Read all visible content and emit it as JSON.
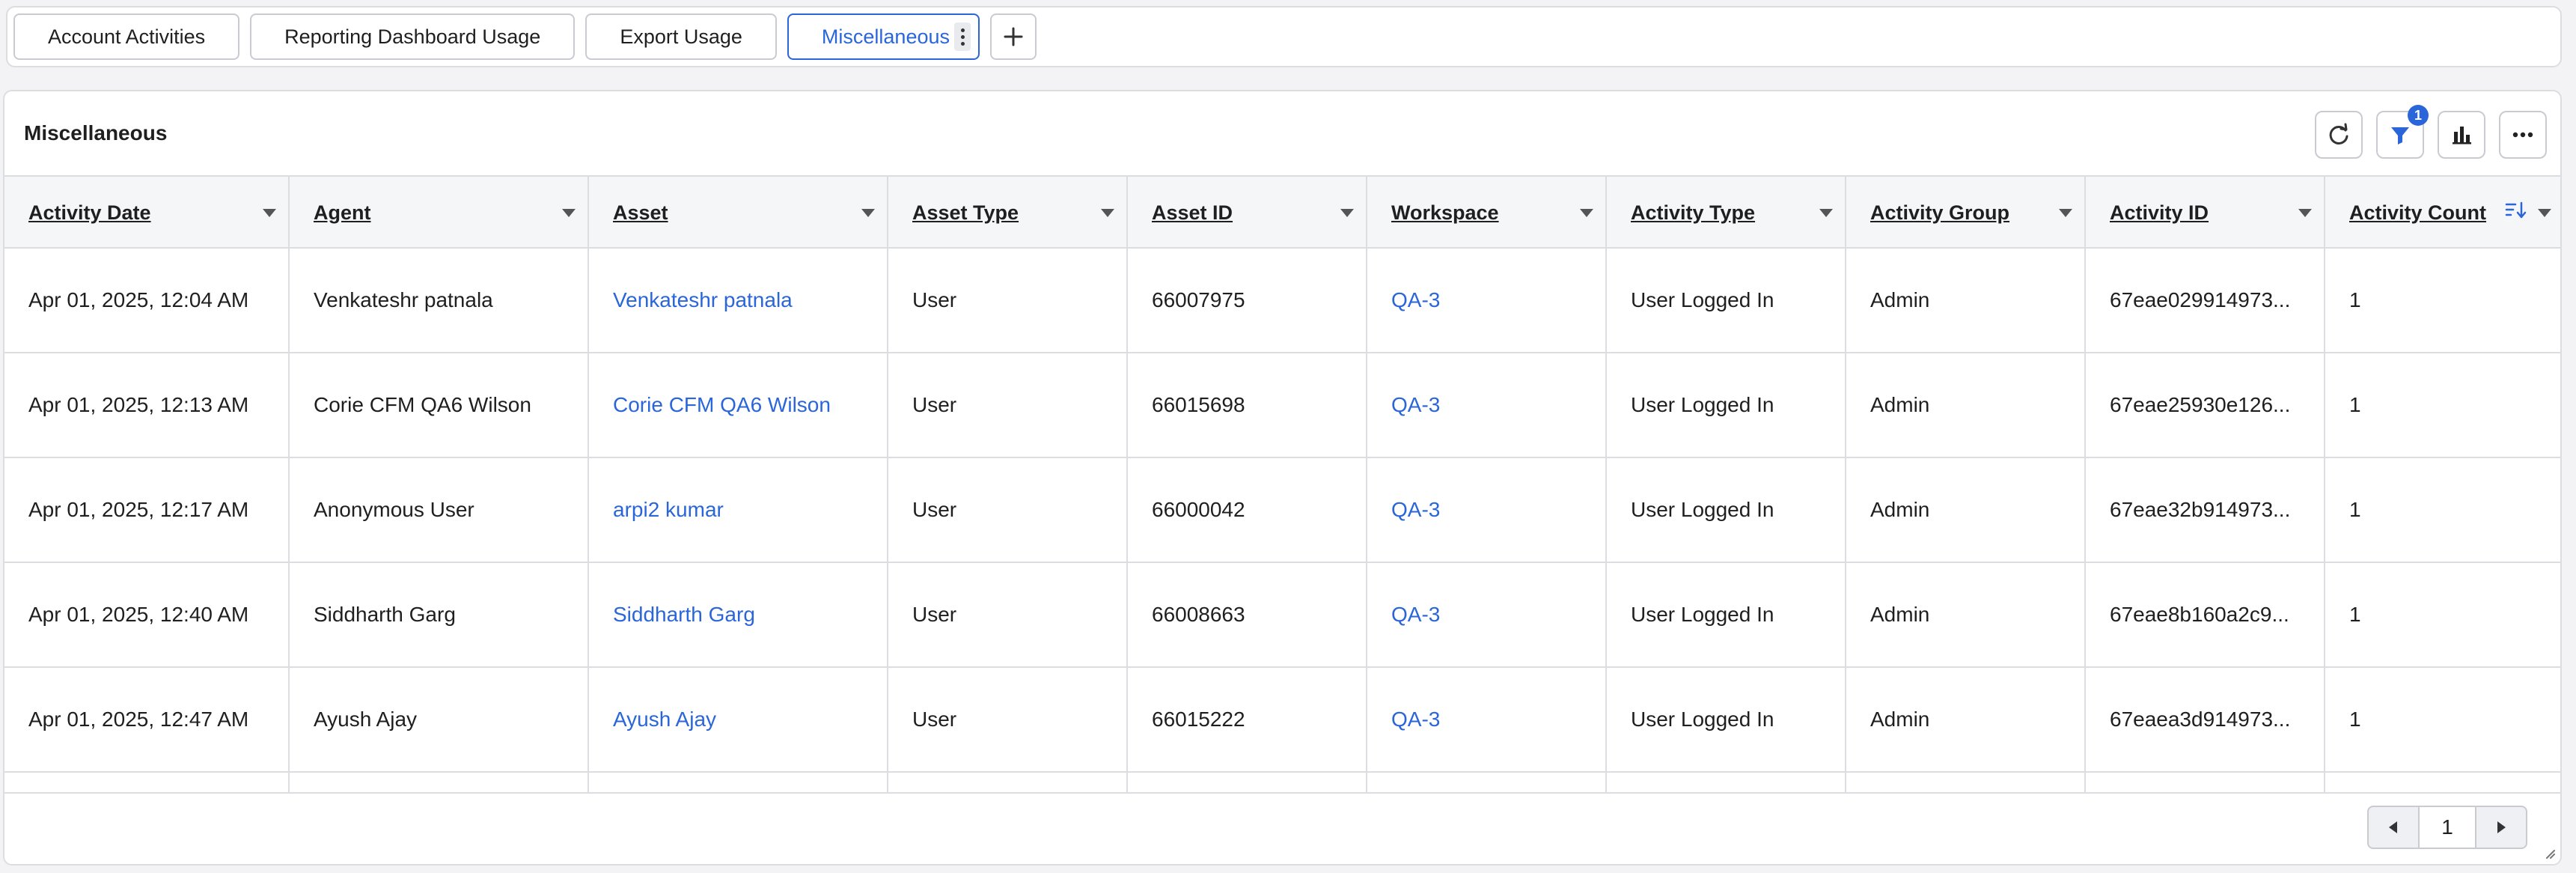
{
  "tabs": [
    {
      "label": "Account Activities",
      "active": false
    },
    {
      "label": "Reporting Dashboard Usage",
      "active": false
    },
    {
      "label": "Export Usage",
      "active": false
    },
    {
      "label": "Miscellaneous",
      "active": true
    }
  ],
  "widget": {
    "title": "Miscellaneous",
    "filter_badge": "1",
    "icons": [
      "refresh-icon",
      "filter-icon",
      "bar-chart-icon",
      "more-icon"
    ]
  },
  "table": {
    "columns": [
      "Activity Date",
      "Agent",
      "Asset",
      "Asset Type",
      "Asset ID",
      "Workspace",
      "Activity Type",
      "Activity Group",
      "Activity ID",
      "Activity Count"
    ],
    "rows": [
      [
        "Apr 01, 2025, 12:04 AM",
        "Venkateshr patnala",
        "Venkateshr patnala",
        "User",
        "66007975",
        "QA-3",
        "User Logged In",
        "Admin",
        "67eae029914973...",
        "1"
      ],
      [
        "Apr 01, 2025, 12:13 AM",
        "Corie CFM QA6 Wilson",
        "Corie CFM QA6 Wilson",
        "User",
        "66015698",
        "QA-3",
        "User Logged In",
        "Admin",
        "67eae25930e126...",
        "1"
      ],
      [
        "Apr 01, 2025, 12:17 AM",
        "Anonymous User",
        "arpi2 kumar",
        "User",
        "66000042",
        "QA-3",
        "User Logged In",
        "Admin",
        "67eae32b914973...",
        "1"
      ],
      [
        "Apr 01, 2025, 12:40 AM",
        "Siddharth Garg",
        "Siddharth Garg",
        "User",
        "66008663",
        "QA-3",
        "User Logged In",
        "Admin",
        "67eae8b160a2c9...",
        "1"
      ],
      [
        "Apr 01, 2025, 12:47 AM",
        "Ayush Ajay",
        "Ayush Ajay",
        "User",
        "66015222",
        "QA-3",
        "User Logged In",
        "Admin",
        "67eaea3d914973...",
        "1"
      ]
    ]
  },
  "pagination": {
    "page": "1"
  },
  "colors": {
    "accent": "#2a66d9",
    "border": "#dcdde1",
    "header_bg": "#f5f6f8"
  }
}
